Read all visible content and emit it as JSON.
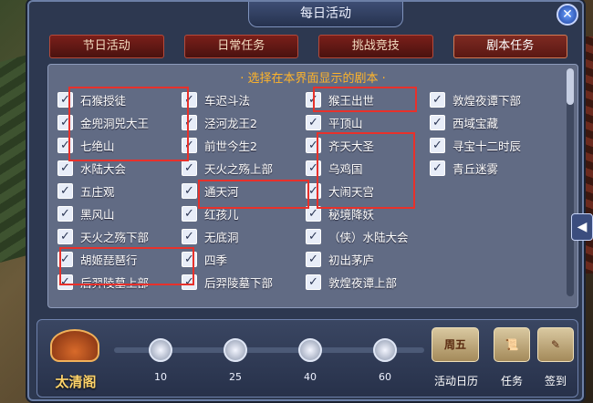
{
  "window": {
    "title": "每日活动",
    "close_icon": "close-icon"
  },
  "tabs": [
    {
      "label": "节日活动"
    },
    {
      "label": "日常任务"
    },
    {
      "label": "挑战竞技"
    },
    {
      "label": "剧本任务"
    }
  ],
  "panel": {
    "heading": "· 选择在本界面显示的剧本 ·"
  },
  "columns": [
    [
      "石猴授徒",
      "金兜洞兕大王",
      "七绝山",
      "水陆大会",
      "五庄观",
      "黑风山",
      "天火之殇下部",
      "胡姬琵琶行",
      "后羿陵墓上部"
    ],
    [
      "车迟斗法",
      "泾河龙王2",
      "前世今生2",
      "天火之殇上部",
      "通天河",
      "红孩儿",
      "无底洞",
      "四季",
      "后羿陵墓下部"
    ],
    [
      "猴王出世",
      "平顶山",
      "齐天大圣",
      "乌鸡国",
      "大闹天宫",
      "秘境降妖",
      "（侠）水陆大会",
      "初出茅庐",
      "敦煌夜谭上部"
    ],
    [
      "敦煌夜谭下部",
      "西域宝藏",
      "寻宝十二时辰",
      "青丘迷雾"
    ]
  ],
  "checkbox_mark": "✓",
  "bottom": {
    "tower_label": "太清阁",
    "progress_value": 0,
    "milestones": [
      "10",
      "25",
      "40",
      "60"
    ],
    "calendar_icon_text": "周五",
    "calendar_label": "活动日历",
    "task_label": "任务",
    "signin_label": "签到"
  },
  "side_arrow": "◀",
  "accent_colors": {
    "highlight": "#e8312b",
    "heading": "#ffb42a",
    "tab": "#7a1f1a"
  }
}
